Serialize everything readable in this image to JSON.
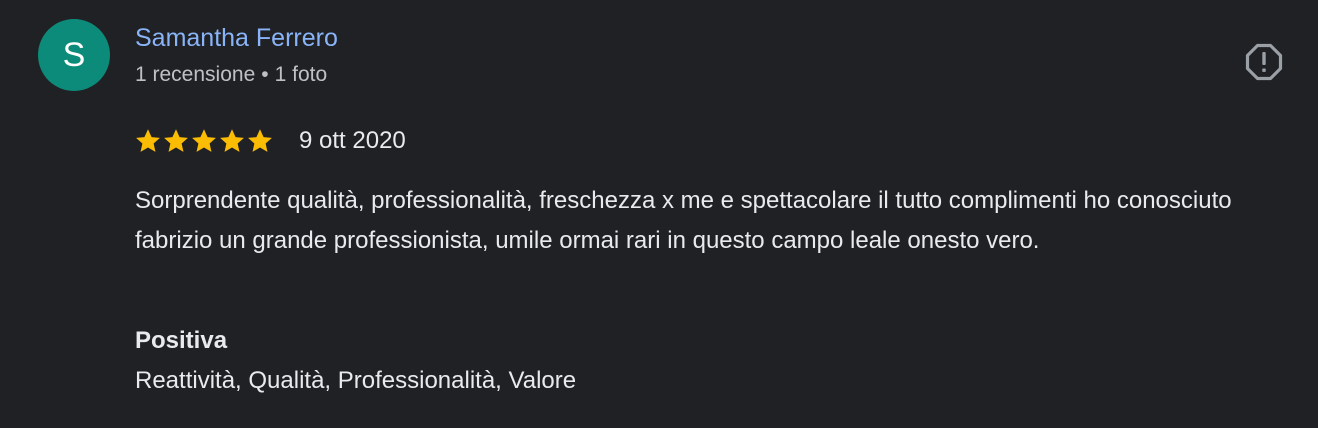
{
  "reviewer": {
    "avatar_letter": "S",
    "avatar_color": "#0d8b7a",
    "name": "Samantha Ferrero",
    "name_color": "#8ab4f8",
    "review_count": "1 recensione",
    "separator": "•",
    "photo_count": "1 foto"
  },
  "actions": {
    "report_icon": "report-flag-octagon-icon"
  },
  "review": {
    "rating": 5,
    "rating_max": 5,
    "star_color": "#fbbc04",
    "date": "9 ott 2020",
    "text": "Sorprendente qualità, professionalità, freschezza x me e spettacolare il tutto complimenti ho conosciuto fabrizio un grande professionista, umile ormai rari in questo campo leale onesto vero."
  },
  "attributes": {
    "heading": "Positiva",
    "values": "Reattività, Qualità, Professionalità, Valore"
  }
}
